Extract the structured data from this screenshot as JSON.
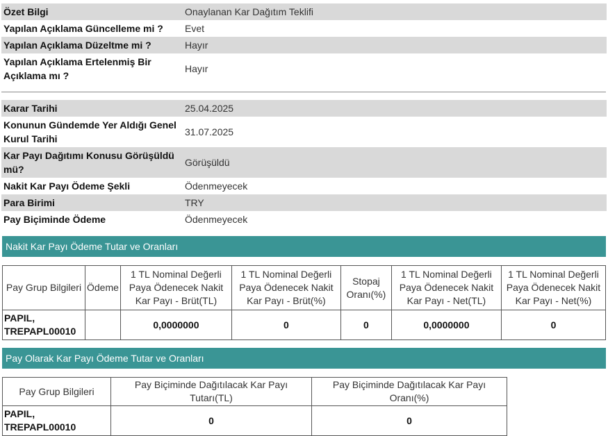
{
  "summary": [
    {
      "label": "Özet Bilgi",
      "value": "Onaylanan Kar Dağıtım Teklifi"
    },
    {
      "label": "Yapılan Açıklama Güncelleme mi ?",
      "value": "Evet"
    },
    {
      "label": "Yapılan Açıklama Düzeltme mi ?",
      "value": "Hayır"
    },
    {
      "label": "Yapılan Açıklama Ertelenmiş Bir Açıklama mı ?",
      "value": "Hayır"
    }
  ],
  "details": [
    {
      "label": "Karar Tarihi",
      "value": "25.04.2025"
    },
    {
      "label": "Konunun Gündemde Yer Aldığı Genel Kurul Tarihi",
      "value": "31.07.2025"
    },
    {
      "label": "Kar Payı Dağıtımı Konusu Görüşüldü mü?",
      "value": "Görüşüldü"
    },
    {
      "label": "Nakit Kar Payı Ödeme Şekli",
      "value": "Ödenmeyecek"
    },
    {
      "label": "Para Birimi",
      "value": "TRY"
    },
    {
      "label": "Pay Biçiminde Ödeme",
      "value": "Ödenmeyecek"
    }
  ],
  "cash_section": {
    "title": "Nakit Kar Payı Ödeme Tutar ve Oranları",
    "headers": [
      "Pay Grup Bilgileri",
      "Ödeme",
      "1 TL Nominal Değerli Paya Ödenecek Nakit Kar Payı - Brüt(TL)",
      "1 TL Nominal Değerli Paya Ödenecek Nakit Kar Payı - Brüt(%)",
      "Stopaj Oranı(%)",
      "1 TL Nominal Değerli Paya Ödenecek Nakit Kar Payı - Net(TL)",
      "1 TL Nominal Değerli Paya Ödenecek Nakit Kar Payı - Net(%)"
    ],
    "row": {
      "group": "PAPIL, TREPAPL00010",
      "payment": "",
      "gross_tl": "0,0000000",
      "gross_pct": "0",
      "withholding": "0",
      "net_tl": "0,0000000",
      "net_pct": "0"
    }
  },
  "share_section": {
    "title": "Pay Olarak Kar Payı Ödeme Tutar ve Oranları",
    "headers": [
      "Pay Grup Bilgileri",
      "Pay Biçiminde Dağıtılacak Kar Payı Tutarı(TL)",
      "Pay Biçiminde Dağıtılacak Kar Payı Oranı(%)"
    ],
    "row": {
      "group": "PAPIL, TREPAPL00010",
      "amount": "0",
      "ratio": "0"
    }
  },
  "colors": {
    "section_bar": "#3a9595",
    "row_shade": "#d9d9d9"
  }
}
